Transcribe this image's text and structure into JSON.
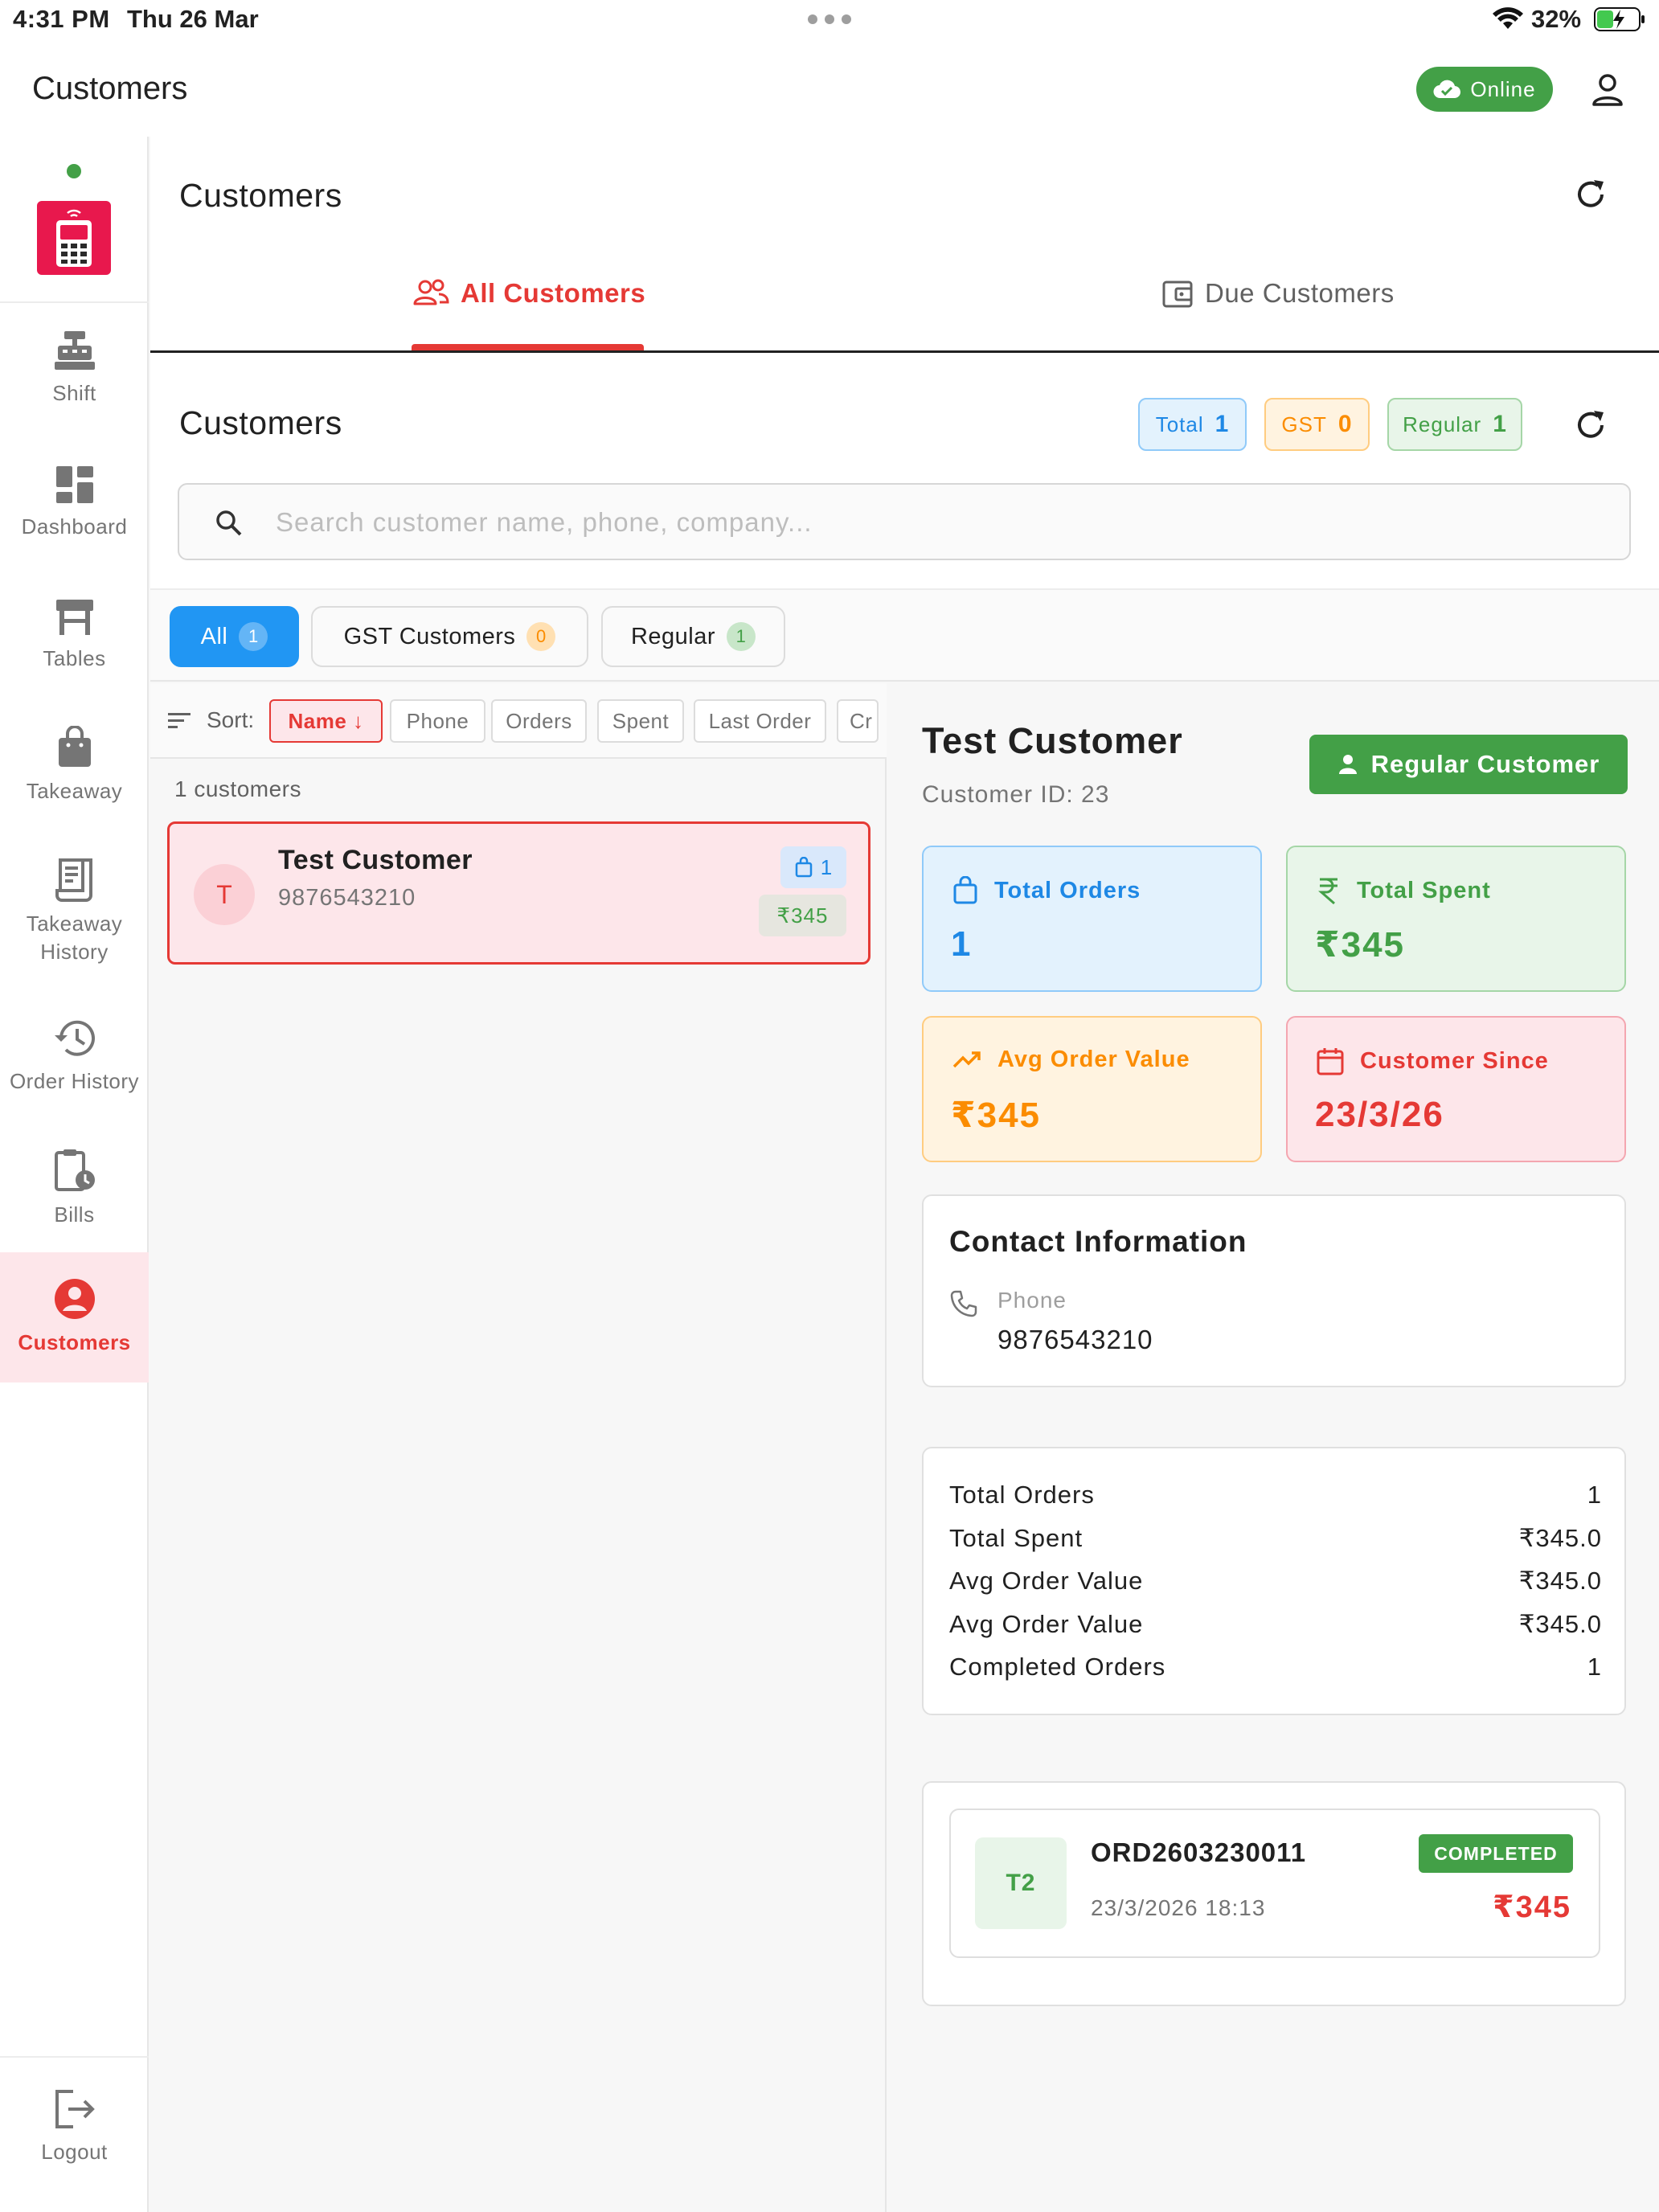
{
  "status_bar": {
    "time": "4:31 PM",
    "date": "Thu 26 Mar",
    "battery": "32%"
  },
  "app_bar": {
    "title": "Customers",
    "status": "Online"
  },
  "sidebar": {
    "items": [
      {
        "label": "Shift"
      },
      {
        "label": "Dashboard"
      },
      {
        "label": "Tables"
      },
      {
        "label": "Takeaway"
      },
      {
        "label": "Takeaway History"
      },
      {
        "label": "Order History"
      },
      {
        "label": "Bills"
      },
      {
        "label": "Customers"
      }
    ],
    "logout": "Logout"
  },
  "header": {
    "title": "Customers",
    "tabs": [
      {
        "label": "All Customers"
      },
      {
        "label": "Due Customers"
      }
    ]
  },
  "section": {
    "title": "Customers",
    "badges": {
      "total_label": "Total",
      "total_value": "1",
      "gst_label": "GST",
      "gst_value": "0",
      "regular_label": "Regular",
      "regular_value": "1"
    },
    "search_placeholder": "Search customer name, phone, company..."
  },
  "filters": [
    {
      "label": "All",
      "count": "1"
    },
    {
      "label": "GST Customers",
      "count": "0"
    },
    {
      "label": "Regular",
      "count": "1"
    }
  ],
  "sort": {
    "label": "Sort:",
    "options": [
      "Name ↓",
      "Phone",
      "Orders",
      "Spent",
      "Last Order",
      "Cr"
    ]
  },
  "list": {
    "count_text": "1 customers",
    "customers": [
      {
        "initial": "T",
        "name": "Test Customer",
        "phone": "9876543210",
        "orders": "1",
        "spent": "₹345"
      }
    ]
  },
  "detail": {
    "name": "Test Customer",
    "customer_id": "Customer ID: 23",
    "type_button": "Regular Customer",
    "stats": {
      "total_orders_label": "Total Orders",
      "total_orders_value": "1",
      "total_spent_label": "Total Spent",
      "total_spent_value": "₹345",
      "avg_order_label": "Avg Order Value",
      "avg_order_value": "₹345",
      "since_label": "Customer Since",
      "since_value": "23/3/26"
    },
    "contact": {
      "title": "Contact Information",
      "phone_label": "Phone",
      "phone_value": "9876543210"
    },
    "summary": [
      {
        "label": "Total Orders",
        "value": "1"
      },
      {
        "label": "Total Spent",
        "value": "₹345.0"
      },
      {
        "label": "Avg Order Value",
        "value": "₹345.0"
      },
      {
        "label": "Avg Order Value",
        "value": "₹345.0"
      },
      {
        "label": "Completed Orders",
        "value": "1"
      }
    ],
    "orders": [
      {
        "table": "T2",
        "order_no": "ORD2603230011",
        "date": "23/3/2026 18:13",
        "status": "COMPLETED",
        "amount": "₹345"
      }
    ]
  },
  "colors": {
    "accent": "#e53935",
    "primary_blue": "#2196f3",
    "success": "#43a047",
    "warning": "#fb8c00"
  }
}
